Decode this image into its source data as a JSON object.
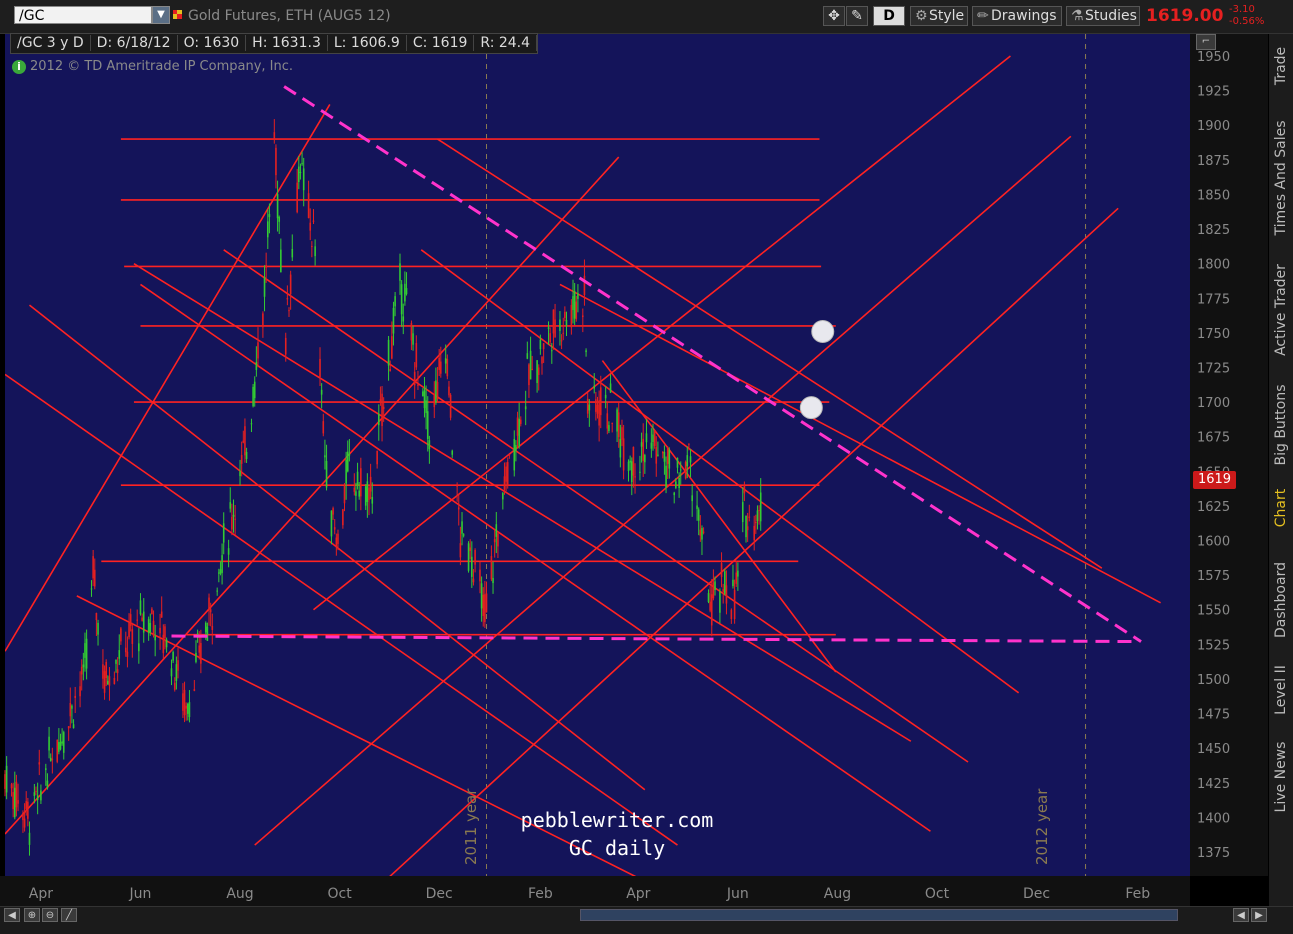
{
  "toolbar": {
    "symbol": "/GC",
    "description": "Gold Futures, ETH (AUG5 12)",
    "period_btn": "D",
    "style_btn": "Style",
    "drawings_btn": "Drawings",
    "studies_btn": "Studies",
    "last_price": "1619.00",
    "change": "-3.10",
    "change_pct": "-0.56%"
  },
  "header": {
    "symbol_period": "/GC 3 y D",
    "date": "D: 6/18/12",
    "open": "O: 1630",
    "high": "H: 1631.3",
    "low": "L: 1606.9",
    "close": "C: 1619",
    "range": "R: 24.4"
  },
  "copyright": "2012 © TD Ameritrade IP Company, Inc.",
  "price_tag": "1619",
  "side_tabs": [
    "Trade",
    "Times And Sales",
    "Active Trader",
    "Big Buttons",
    "Chart",
    "Dashboard",
    "Level II",
    "Live News"
  ],
  "watermark": {
    "line1": "pebblewriter.com",
    "line2": "GC daily"
  },
  "year_markers": [
    "2011 year",
    "2012 year"
  ],
  "colors": {
    "background": "#14145a",
    "up": "#33cc33",
    "down": "#e52020",
    "trendline": "#ff2222",
    "dashed": "#ff33cc",
    "last_price": "#e52020"
  },
  "chart_data": {
    "type": "candlestick",
    "title": "",
    "ylim": [
      1350,
      1960
    ],
    "y_ticks": [
      1375,
      1400,
      1425,
      1450,
      1475,
      1500,
      1525,
      1550,
      1575,
      1600,
      1625,
      1650,
      1675,
      1700,
      1725,
      1750,
      1775,
      1800,
      1825,
      1850,
      1875,
      1900,
      1925,
      1950
    ],
    "x_ticks": [
      "Apr",
      "Jun",
      "Aug",
      "Oct",
      "Dec",
      "Feb",
      "Apr",
      "Jun",
      "Aug",
      "Oct",
      "Dec",
      "Feb"
    ],
    "x_range": [
      "2011-03-10",
      "2013-03-05"
    ],
    "tick_dates": [
      "2011-04-01",
      "2011-06-01",
      "2011-08-01",
      "2011-10-01",
      "2011-12-01",
      "2012-02-01",
      "2012-04-01",
      "2012-06-01",
      "2012-08-01",
      "2012-10-01",
      "2012-12-01",
      "2013-02-01"
    ],
    "year_dates": [
      "2011-12-30",
      "2012-12-31"
    ],
    "price_path": [
      [
        "2011-03-10",
        1430
      ],
      [
        "2011-03-25",
        1400
      ],
      [
        "2011-04-08",
        1445
      ],
      [
        "2011-04-28",
        1505
      ],
      [
        "2011-05-03",
        1575
      ],
      [
        "2011-05-10",
        1500
      ],
      [
        "2011-05-28",
        1535
      ],
      [
        "2011-06-08",
        1545
      ],
      [
        "2011-06-17",
        1530
      ],
      [
        "2011-06-29",
        1480
      ],
      [
        "2011-07-12",
        1540
      ],
      [
        "2011-07-27",
        1620
      ],
      [
        "2011-08-05",
        1670
      ],
      [
        "2011-08-16",
        1780
      ],
      [
        "2011-08-22",
        1890
      ],
      [
        "2011-08-29",
        1750
      ],
      [
        "2011-09-06",
        1870
      ],
      [
        "2011-09-15",
        1820
      ],
      [
        "2011-09-23",
        1640
      ],
      [
        "2011-09-30",
        1600
      ],
      [
        "2011-10-06",
        1650
      ],
      [
        "2011-10-20",
        1630
      ],
      [
        "2011-11-01",
        1740
      ],
      [
        "2011-11-08",
        1785
      ],
      [
        "2011-11-18",
        1720
      ],
      [
        "2011-11-25",
        1680
      ],
      [
        "2011-12-05",
        1740
      ],
      [
        "2011-12-14",
        1600
      ],
      [
        "2011-12-20",
        1595
      ],
      [
        "2011-12-29",
        1545
      ],
      [
        "2012-01-10",
        1640
      ],
      [
        "2012-01-25",
        1720
      ],
      [
        "2012-02-08",
        1750
      ],
      [
        "2012-02-21",
        1770
      ],
      [
        "2012-02-28",
        1780
      ],
      [
        "2012-03-01",
        1700
      ],
      [
        "2012-03-12",
        1700
      ],
      [
        "2012-03-28",
        1660
      ],
      [
        "2012-04-10",
        1670
      ],
      [
        "2012-04-24",
        1640
      ],
      [
        "2012-05-02",
        1660
      ],
      [
        "2012-05-16",
        1550
      ],
      [
        "2012-05-24",
        1570
      ],
      [
        "2012-05-30",
        1555
      ],
      [
        "2012-06-05",
        1620
      ],
      [
        "2012-06-18",
        1619
      ]
    ],
    "horizontal_levels": [
      {
        "y": 1890,
        "from": "2011-05-20",
        "to": "2012-07-21"
      },
      {
        "y": 1846,
        "from": "2011-05-20",
        "to": "2012-07-21"
      },
      {
        "y": 1798,
        "from": "2011-05-22",
        "to": "2012-07-22"
      },
      {
        "y": 1755,
        "from": "2011-06-01",
        "to": "2012-07-31"
      },
      {
        "y": 1700,
        "from": "2011-05-28",
        "to": "2012-07-27"
      },
      {
        "y": 1640,
        "from": "2011-05-20",
        "to": "2012-07-21"
      },
      {
        "y": 1585,
        "from": "2011-05-08",
        "to": "2012-07-08"
      },
      {
        "y": 1532,
        "from": "2011-06-29",
        "to": "2012-07-31"
      }
    ],
    "dashed_lines": [
      [
        [
          "2011-08-28",
          1928
        ],
        [
          "2013-02-03",
          1527
        ]
      ],
      [
        [
          "2011-06-20",
          1531
        ],
        [
          "2013-01-31",
          1527
        ]
      ]
    ],
    "channel_lines": [
      [
        [
          "2011-03-25",
          1770
        ],
        [
          "2012-04-05",
          1420
        ]
      ],
      [
        [
          "2011-03-10",
          1720
        ],
        [
          "2012-04-25",
          1380
        ]
      ],
      [
        [
          "2011-04-23",
          1560
        ],
        [
          "2012-07-05",
          1300
        ]
      ],
      [
        [
          "2011-05-28",
          1800
        ],
        [
          "2012-09-15",
          1455
        ]
      ],
      [
        [
          "2011-06-01",
          1785
        ],
        [
          "2012-09-27",
          1390
        ]
      ],
      [
        [
          "2011-07-22",
          1810
        ],
        [
          "2012-10-20",
          1440
        ]
      ],
      [
        [
          "2011-11-20",
          1810
        ],
        [
          "2012-11-20",
          1490
        ]
      ],
      [
        [
          "2011-11-30",
          1890
        ],
        [
          "2013-01-10",
          1580
        ]
      ],
      [
        [
          "2012-02-13",
          1785
        ],
        [
          "2013-02-15",
          1555
        ]
      ],
      [
        [
          "2012-03-10",
          1730
        ],
        [
          "2012-07-31",
          1505
        ]
      ]
    ],
    "rising_lines": [
      [
        [
          "2011-03-10",
          1520
        ],
        [
          "2011-09-25",
          1915
        ]
      ],
      [
        [
          "2011-03-10",
          1388
        ],
        [
          "2012-03-20",
          1877
        ]
      ],
      [
        [
          "2011-09-15",
          1550
        ],
        [
          "2012-11-15",
          1950
        ]
      ],
      [
        [
          "2011-08-10",
          1380
        ],
        [
          "2012-12-22",
          1892
        ]
      ],
      [
        [
          "2011-10-25",
          1350
        ],
        [
          "2013-01-20",
          1840
        ]
      ]
    ],
    "markers": [
      {
        "date": "2012-07-23",
        "y": 1751
      },
      {
        "date": "2012-07-16",
        "y": 1696
      }
    ]
  }
}
